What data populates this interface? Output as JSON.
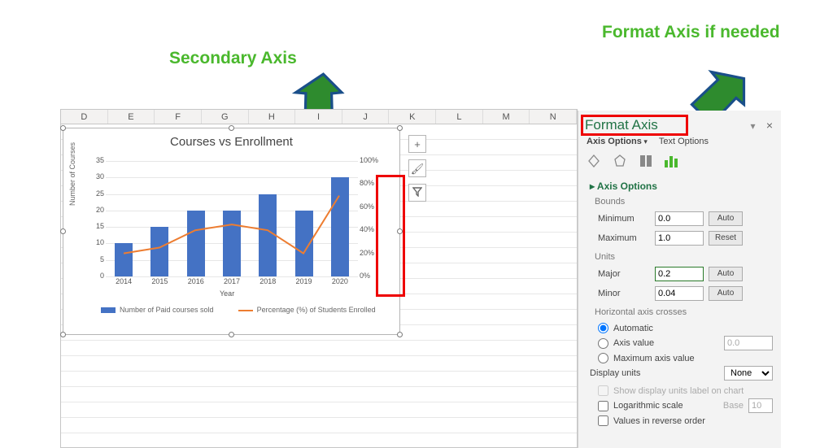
{
  "annotations": {
    "top_right": "Format Axis if needed",
    "left": "Secondary Axis"
  },
  "columns": [
    "D",
    "E",
    "F",
    "G",
    "H",
    "I",
    "J",
    "K",
    "L",
    "M",
    "N"
  ],
  "chart": {
    "title": "Courses vs Enrollment",
    "y_label": "Number of Courses",
    "y2_label": "",
    "x_label": "Year",
    "y_ticks": [
      "35",
      "30",
      "25",
      "20",
      "15",
      "10",
      "5",
      "0"
    ],
    "y2_ticks": [
      "100%",
      "80%",
      "60%",
      "40%",
      "20%",
      "0%"
    ],
    "x_ticks": [
      "2014",
      "2015",
      "2016",
      "2017",
      "2018",
      "2019",
      "2020"
    ],
    "legend": {
      "s1": "Number of Paid courses sold",
      "s2": "Percentage (%) of Students Enrolled"
    }
  },
  "side_buttons": {
    "plus": "+",
    "brush": "🖌",
    "filter": "▾"
  },
  "panel": {
    "title": "Format Axis",
    "close": "×",
    "menu_dd": "▾",
    "tabs": {
      "options": "Axis Options",
      "text": "Text Options"
    },
    "section1": "Axis Options",
    "bounds": "Bounds",
    "min_label": "Minimum",
    "min_val": "0.0",
    "min_btn": "Auto",
    "max_label": "Maximum",
    "max_val": "1.0",
    "max_btn": "Reset",
    "units": "Units",
    "major_label": "Major",
    "major_val": "0.2",
    "major_btn": "Auto",
    "minor_label": "Minor",
    "minor_val": "0.04",
    "minor_btn": "Auto",
    "haxis": "Horizontal axis crosses",
    "auto": "Automatic",
    "axval": "Axis value",
    "axval_num": "0.0",
    "maxax": "Maximum axis value",
    "dunits": "Display units",
    "dunits_val": "None",
    "showlbl": "Show display units label on chart",
    "logscale": "Logarithmic scale",
    "base_lbl": "Base",
    "base_val": "10",
    "revorder": "Values in reverse order"
  },
  "chart_data": {
    "type": "bar+line",
    "categories": [
      "2014",
      "2015",
      "2016",
      "2017",
      "2018",
      "2019",
      "2020"
    ],
    "series": [
      {
        "name": "Number of Paid courses sold",
        "type": "bar",
        "yaxis": "primary",
        "values": [
          10,
          15,
          20,
          20,
          25,
          20,
          30
        ]
      },
      {
        "name": "Percentage (%) of Students Enrolled",
        "type": "line",
        "yaxis": "secondary",
        "values": [
          0.2,
          0.25,
          0.4,
          0.45,
          0.4,
          0.2,
          0.7
        ]
      }
    ],
    "ylim": [
      0,
      35
    ],
    "y2lim": [
      0,
      1
    ],
    "xlabel": "Year",
    "ylabel": "Number of Courses",
    "title": "Courses vs Enrollment"
  }
}
